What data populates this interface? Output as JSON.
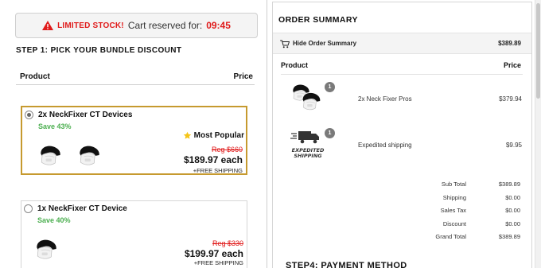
{
  "timer": {
    "limited_label": "LIMITED STOCK!",
    "text": "Cart reserved for:",
    "countdown": "09:45"
  },
  "step1": {
    "heading": "STEP 1: PICK YOUR BUNDLE DISCOUNT",
    "col_product": "Product",
    "col_price": "Price"
  },
  "bundles": [
    {
      "title": "2x NeckFixer CT Devices",
      "save": "Save 43%",
      "badge": "Most Popular",
      "reg": "Reg $660",
      "price": "$189.97 each",
      "shipping": "+FREE SHIPPING",
      "selected": true,
      "image_count": 2
    },
    {
      "title": "1x NeckFixer CT Device",
      "save": "Save 40%",
      "reg": "Reg $330",
      "price": "$199.97 each",
      "shipping": "+FREE SHIPPING",
      "selected": false,
      "image_count": 1
    }
  ],
  "summary": {
    "title": "ORDER SUMMARY",
    "hide_label": "Hide Order Summary",
    "hide_amount": "$389.89",
    "col_product": "Product",
    "col_price": "Price",
    "items": [
      {
        "qty": "1",
        "name": "2x Neck Fixer Pros",
        "price": "$379.94",
        "icon": "neck-device-icon"
      },
      {
        "qty": "1",
        "name": "Expedited shipping",
        "price": "$9.95",
        "icon": "expedited-shipping-icon",
        "icon_text": "EXPEDITED SHIPPING"
      }
    ],
    "totals": [
      {
        "label": "Sub Total",
        "value": "$389.89"
      },
      {
        "label": "Shipping",
        "value": "$0.00"
      },
      {
        "label": "Sales Tax",
        "value": "$0.00"
      },
      {
        "label": "Discount",
        "value": "$0.00"
      },
      {
        "label": "Grand Total",
        "value": "$389.89"
      }
    ]
  },
  "step4": {
    "heading": "STEP4: PAYMENT METHOD"
  },
  "colors": {
    "accent_red": "#e01b1b",
    "save_green": "#4caf50",
    "selected_border": "#c69a2f",
    "star_yellow": "#f5c518"
  }
}
